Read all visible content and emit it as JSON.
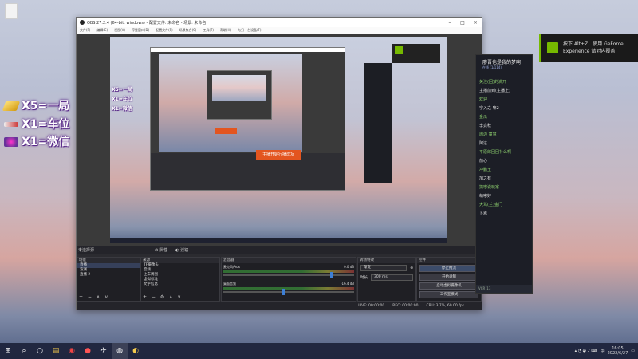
{
  "desktop": {
    "overlay": [
      {
        "icon": "gold-bar-icon",
        "text": "X5=一局"
      },
      {
        "icon": "jet-icon",
        "text": "X1=车位"
      },
      {
        "icon": "mech-icon",
        "text": "X1=微信"
      }
    ]
  },
  "obs": {
    "title": "OBS 27.2.4 (64-bit, windows) - 配置文件: 未命名 - 场景: 未命名",
    "menu": [
      "文件(F)",
      "编辑(E)",
      "视图(V)",
      "停靠窗口(D)",
      "配置文件(P)",
      "场景集合(S)",
      "工具(T)",
      "帮助(H)",
      "与另一台设备(F)"
    ],
    "scene_label": "未选择源",
    "scene_tabs": [
      "属性",
      "滤镜"
    ],
    "scenes": {
      "header": "场景",
      "items": [
        "直播",
        "波澜",
        "直播 2"
      ],
      "selected": 0
    },
    "sources": {
      "header": "来源",
      "items": [
        "TF摄像头",
        "音频",
        "上车周围",
        "虚拟标准",
        "文字信息",
        "转播插件",
        "采录中"
      ]
    },
    "mixer": {
      "header": "混音器",
      "tracks": [
        {
          "name": "麦克风/Aux",
          "db": "0.0 dB",
          "level": 0.82
        },
        {
          "name": "桌面音频",
          "db": "-16.4 dB",
          "level": 0.45
        }
      ]
    },
    "transitions": {
      "header": "转场特效",
      "type": "渐变",
      "duration_label": "时长",
      "duration": "300 ms"
    },
    "controls": {
      "header": "控件",
      "buttons": [
        "停止推流",
        "开始录制",
        "启动虚拟摄像机",
        "工作室模式",
        "设置",
        "退出"
      ]
    },
    "status": {
      "live": "LIVE: 00:00:00",
      "rec": "REC: 00:00:00",
      "cpu": "CPU: 3.7%, 60.00 fps"
    },
    "preview_note": "主播开始行播成功"
  },
  "chat": {
    "title": "廖晋也是我的梦啊",
    "subtitle": "在线",
    "count": "(1/114)",
    "lines": [
      "关注(回)的满开",
      "主播前到(主播上)",
      "欢迎",
      "宁入之 嘛2",
      "金瓜",
      "李竟秋",
      "周边 童慧",
      "阿达",
      "平原郎回回补么啊",
      "前心",
      "冲鹏王",
      "加之有",
      "搞嘟说玩家",
      "萌嘟好",
      "大骂(兰)金门",
      "卜嵩"
    ],
    "footer": "VCR_13"
  },
  "nvidia": {
    "line1": "按下 Alt+Z，使用 GeForce",
    "line2": "Experience 请对内覆盖"
  },
  "taskbar": {
    "time": "16:05",
    "date": "2022/6/27",
    "lang": "中"
  }
}
